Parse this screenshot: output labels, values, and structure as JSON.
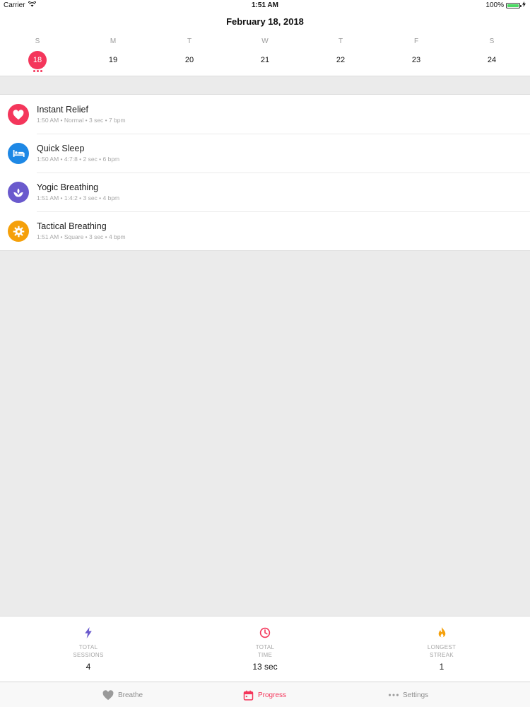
{
  "status_bar": {
    "carrier": "Carrier",
    "time": "1:51 AM",
    "battery": "100%",
    "battery_level": 1.0
  },
  "header": {
    "title": "February 18, 2018"
  },
  "calendar": {
    "days": [
      {
        "letter": "S",
        "num": "18",
        "selected": true,
        "dots": 3
      },
      {
        "letter": "M",
        "num": "19",
        "selected": false,
        "dots": 0
      },
      {
        "letter": "T",
        "num": "20",
        "selected": false,
        "dots": 0
      },
      {
        "letter": "W",
        "num": "21",
        "selected": false,
        "dots": 0
      },
      {
        "letter": "T",
        "num": "22",
        "selected": false,
        "dots": 0
      },
      {
        "letter": "F",
        "num": "23",
        "selected": false,
        "dots": 0
      },
      {
        "letter": "S",
        "num": "24",
        "selected": false,
        "dots": 0
      }
    ],
    "accent": "#f4365b"
  },
  "sessions": [
    {
      "title": "Instant Relief",
      "subtitle": "1:50 AM • Normal • 3 sec • 7 bpm",
      "icon": "heart-icon",
      "color": "#f4365b"
    },
    {
      "title": "Quick Sleep",
      "subtitle": "1:50 AM • 4:7:8 • 2 sec • 6 bpm",
      "icon": "bed-icon",
      "color": "#1e88e5"
    },
    {
      "title": "Yogic Breathing",
      "subtitle": "1:51 AM • 1:4:2 • 3 sec • 4 bpm",
      "icon": "lotus-icon",
      "color": "#6a5acd"
    },
    {
      "title": "Tactical Breathing",
      "subtitle": "1:51 AM • Square • 3 sec • 4 bpm",
      "icon": "gear-icon",
      "color": "#f5a00a"
    }
  ],
  "stats": [
    {
      "label": "TOTAL\nSESSIONS",
      "value": "4",
      "icon": "lightning-icon",
      "color": "#6a5acd"
    },
    {
      "label": "TOTAL\nTIME",
      "value": "13 sec",
      "icon": "clock-icon",
      "color": "#f4365b"
    },
    {
      "label": "LONGEST\nSTREAK",
      "value": "1",
      "icon": "flame-icon",
      "color": "#f5a00a"
    }
  ],
  "tabs": [
    {
      "label": "Breathe",
      "icon": "heart-icon",
      "active": false
    },
    {
      "label": "Progress",
      "icon": "calendar-icon",
      "active": true
    },
    {
      "label": "Settings",
      "icon": "more-icon",
      "active": false
    }
  ]
}
